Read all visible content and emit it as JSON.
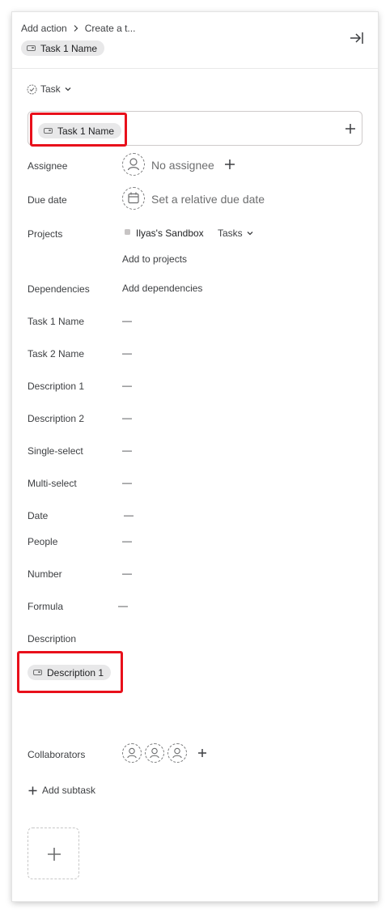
{
  "header": {
    "breadcrumb": [
      "Add action",
      "Create a t..."
    ],
    "variable_chip": "Task 1 Name"
  },
  "task_type": "Task",
  "name_field": {
    "chip": "Task 1 Name"
  },
  "fields": {
    "assignee": {
      "label": "Assignee",
      "value": "No assignee"
    },
    "due_date": {
      "label": "Due date",
      "value": "Set a relative due date"
    },
    "projects": {
      "label": "Projects",
      "project": "Ilyas's Sandbox",
      "section": "Tasks",
      "add_link": "Add to projects"
    },
    "dependencies": {
      "label": "Dependencies",
      "value": "Add dependencies"
    }
  },
  "custom_fields": [
    {
      "label": "Task 1 Name",
      "value": "—"
    },
    {
      "label": "Task 2 Name",
      "value": "—"
    },
    {
      "label": "Description 1",
      "value": "—"
    },
    {
      "label": "Description 2",
      "value": "—"
    },
    {
      "label": "Single-select",
      "value": "—"
    },
    {
      "label": "Multi-select",
      "value": "—"
    },
    {
      "label": "Date",
      "value": "—"
    },
    {
      "label": "People",
      "value": "—"
    },
    {
      "label": "Number",
      "value": "—"
    },
    {
      "label": "Formula",
      "value": "—"
    }
  ],
  "description": {
    "label": "Description",
    "chip": "Description 1"
  },
  "collaborators": {
    "label": "Collaborators"
  },
  "add_subtask": "Add subtask",
  "colors": {
    "highlight": "#e8101b",
    "chip_bg": "#e8e8e9",
    "text": "#1e1f21",
    "muted": "#6d6e6f"
  }
}
